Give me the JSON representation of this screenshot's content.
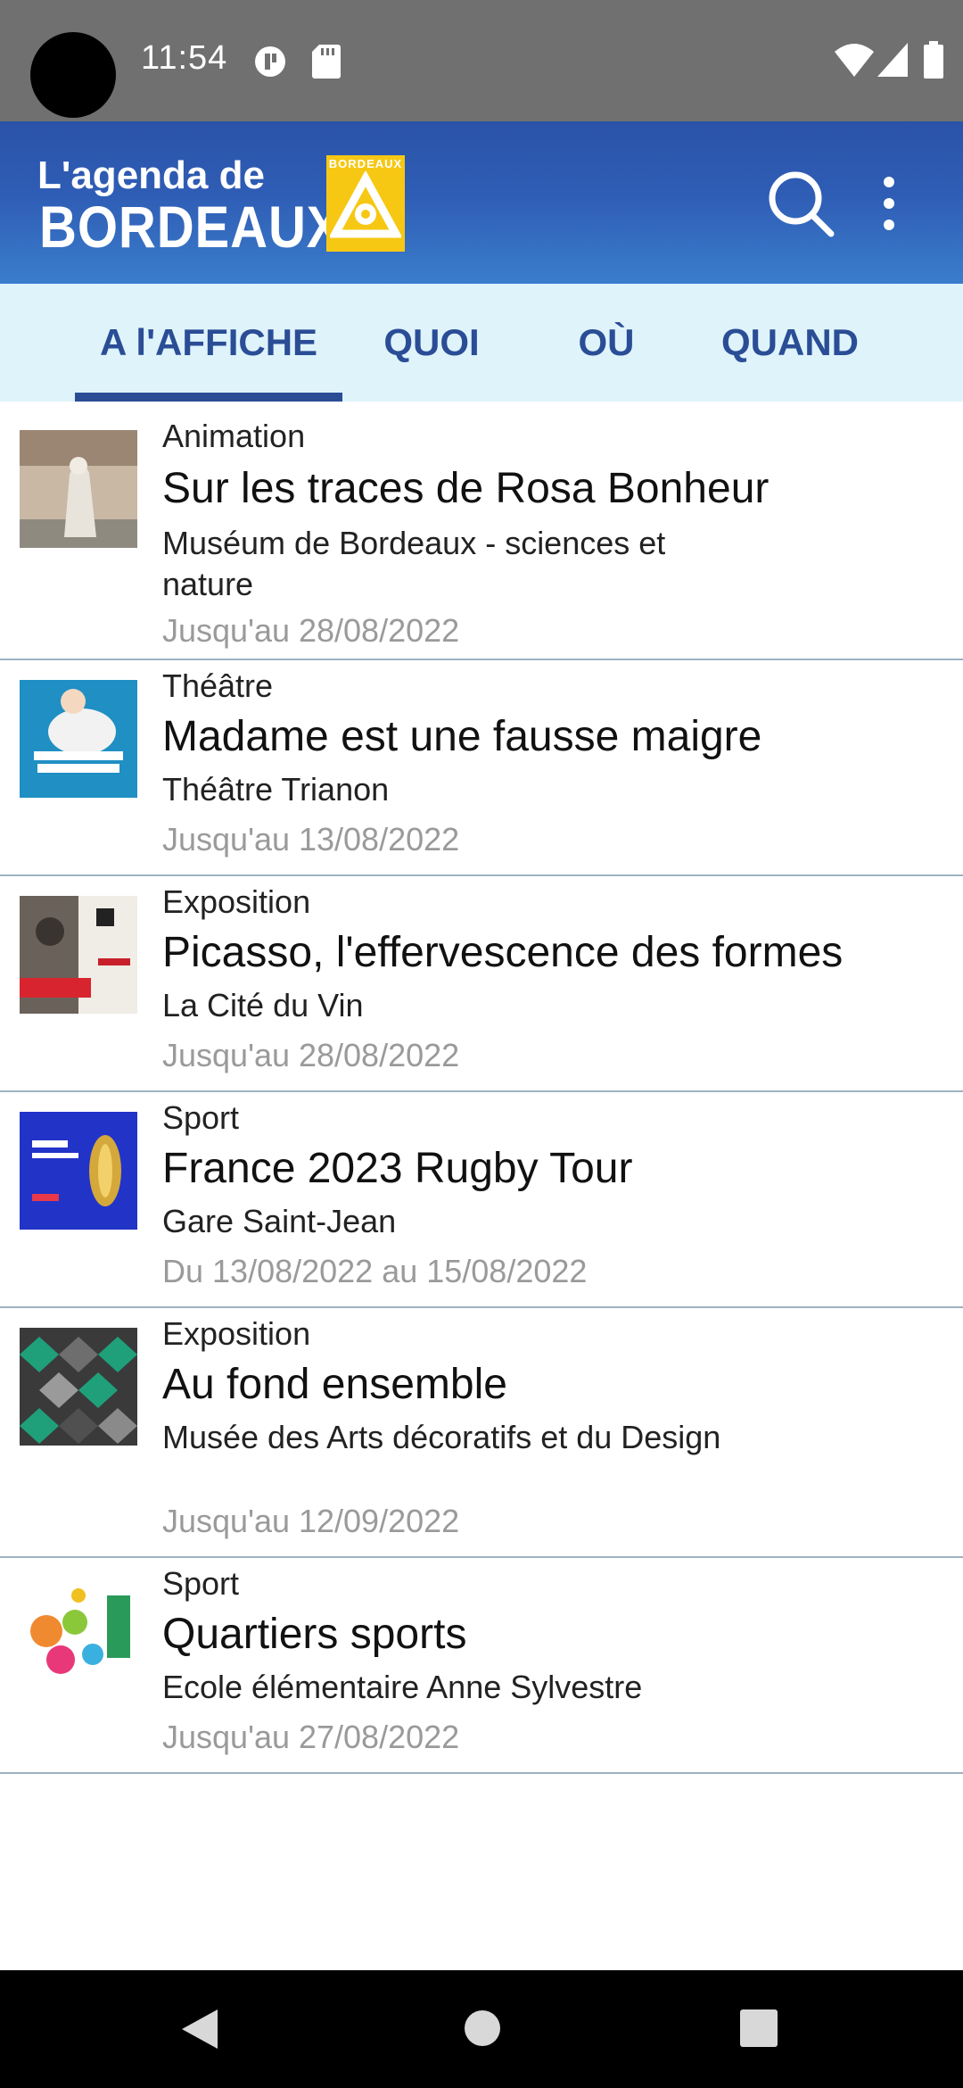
{
  "status_bar": {
    "time": "11:54",
    "icons": [
      "vpn-key-icon",
      "sd-card-icon",
      "wifi-icon",
      "signal-icon",
      "battery-icon"
    ]
  },
  "header": {
    "logo_line1": "L'agenda de",
    "logo_line2": "BORDEAUX",
    "logo_badge_text": "BORDEAUX",
    "actions": [
      "search-icon",
      "more-vert-icon"
    ],
    "colors": {
      "header_top": "#2a53a8",
      "header_bottom": "#3a7dcc",
      "badge": "#f6c814"
    }
  },
  "tabs": [
    {
      "label": "A l'AFFICHE",
      "selected": true
    },
    {
      "label": "QUOI",
      "selected": false
    },
    {
      "label": "OÙ",
      "selected": false
    },
    {
      "label": "QUAND",
      "selected": false
    }
  ],
  "events": [
    {
      "category": "Animation",
      "title": "Sur les traces de Rosa Bonheur",
      "place": "Muséum de Bordeaux - sciences et nature",
      "date": "Jusqu'au 28/08/2022"
    },
    {
      "category": "Théâtre",
      "title": "Madame est une fausse maigre",
      "place": "Théâtre Trianon",
      "date": "Jusqu'au 13/08/2022"
    },
    {
      "category": "Exposition",
      "title": "Picasso, l'effervescence des formes",
      "place": "La Cité du Vin",
      "date": "Jusqu'au 28/08/2022"
    },
    {
      "category": "Sport",
      "title": "France 2023 Rugby Tour",
      "place": "Gare Saint-Jean",
      "date": "Du 13/08/2022 au 15/08/2022"
    },
    {
      "category": "Exposition",
      "title": "Au fond ensemble",
      "place": "Musée des Arts décoratifs et du Design",
      "date": "Jusqu'au 12/09/2022"
    },
    {
      "category": "Sport",
      "title": "Quartiers sports",
      "place": "Ecole élémentaire Anne Sylvestre",
      "date": "Jusqu'au 27/08/2022"
    }
  ],
  "nav_bar": {
    "buttons": [
      "back-icon",
      "home-icon",
      "recents-icon"
    ]
  }
}
